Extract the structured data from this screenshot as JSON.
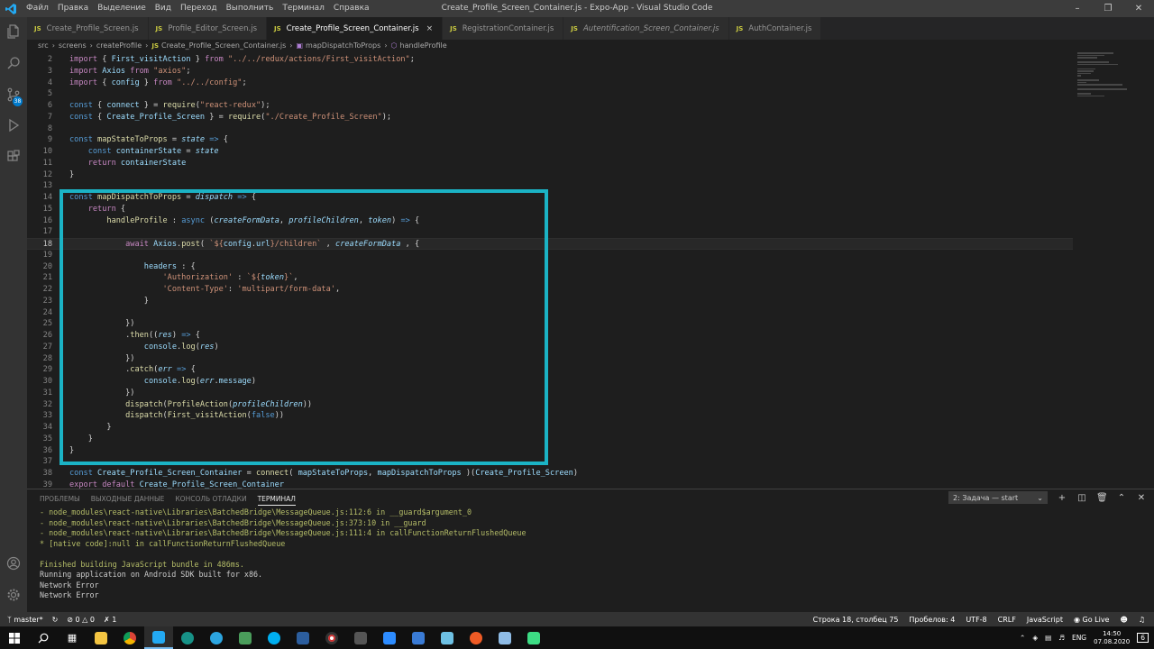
{
  "window": {
    "title": "Create_Profile_Screen_Container.js - Expo-App - Visual Studio Code",
    "menu": [
      "Файл",
      "Правка",
      "Выделение",
      "Вид",
      "Переход",
      "Выполнить",
      "Терминал",
      "Справка"
    ]
  },
  "activity_bar": {
    "scm_badge": "38"
  },
  "tabs": [
    {
      "label": "Create_Profile_Screen.js",
      "active": false,
      "italic": false
    },
    {
      "label": "Profile_Editor_Screen.js",
      "active": false,
      "italic": false
    },
    {
      "label": "Create_Profile_Screen_Container.js",
      "active": true,
      "italic": false
    },
    {
      "label": "RegistrationContainer.js",
      "active": false,
      "italic": false
    },
    {
      "label": "Autentification_Screen_Container.js",
      "active": false,
      "italic": true
    },
    {
      "label": "AuthContainer.js",
      "active": false,
      "italic": false
    }
  ],
  "tab_icon": "JS",
  "breadcrumb": [
    "src",
    "screens",
    "createProfile",
    "Create_Profile_Screen_Container.js",
    "mapDispatchToProps",
    "handleProfile"
  ],
  "code_lines": [
    {
      "n": "2",
      "t": [
        [
          "kw",
          "import"
        ],
        [
          "pr",
          " { "
        ],
        [
          "vr",
          "First_visitAction"
        ],
        [
          "pr",
          " } "
        ],
        [
          "kw",
          "from"
        ],
        [
          "st",
          " \"../../redux/actions/First_visitAction\""
        ],
        [
          "pr",
          ";"
        ]
      ]
    },
    {
      "n": "3",
      "t": [
        [
          "kw",
          "import"
        ],
        [
          "vr",
          " Axios "
        ],
        [
          "kw",
          "from"
        ],
        [
          "st",
          " \"axios\""
        ],
        [
          "pr",
          ";"
        ]
      ]
    },
    {
      "n": "4",
      "t": [
        [
          "kw",
          "import"
        ],
        [
          "pr",
          " { "
        ],
        [
          "vr",
          "config"
        ],
        [
          "pr",
          " } "
        ],
        [
          "kw",
          "from"
        ],
        [
          "st",
          " \"../../config\""
        ],
        [
          "pr",
          ";"
        ]
      ]
    },
    {
      "n": "5",
      "t": []
    },
    {
      "n": "6",
      "t": [
        [
          "sk",
          "const"
        ],
        [
          "pr",
          " { "
        ],
        [
          "vr",
          "connect"
        ],
        [
          "pr",
          " } = "
        ],
        [
          "fn",
          "require"
        ],
        [
          "pr",
          "("
        ],
        [
          "st",
          "\"react-redux\""
        ],
        [
          "pr",
          ");"
        ]
      ]
    },
    {
      "n": "7",
      "t": [
        [
          "sk",
          "const"
        ],
        [
          "pr",
          " { "
        ],
        [
          "vr",
          "Create_Profile_Screen"
        ],
        [
          "pr",
          " } = "
        ],
        [
          "fn",
          "require"
        ],
        [
          "pr",
          "("
        ],
        [
          "st",
          "\"./Create_Profile_Screen\""
        ],
        [
          "pr",
          ");"
        ]
      ]
    },
    {
      "n": "8",
      "t": []
    },
    {
      "n": "9",
      "t": [
        [
          "sk",
          "const"
        ],
        [
          "fn",
          " mapStateToProps"
        ],
        [
          "pr",
          " = "
        ],
        [
          "pm",
          "state"
        ],
        [
          "sk",
          " =>"
        ],
        [
          "pr",
          " {"
        ]
      ]
    },
    {
      "n": "10",
      "t": [
        [
          "pr",
          "    "
        ],
        [
          "sk",
          "const"
        ],
        [
          "vr",
          " containerState"
        ],
        [
          "pr",
          " = "
        ],
        [
          "pm",
          "state"
        ]
      ]
    },
    {
      "n": "11",
      "t": [
        [
          "pr",
          "    "
        ],
        [
          "kw",
          "return"
        ],
        [
          "vr",
          " containerState"
        ]
      ]
    },
    {
      "n": "12",
      "t": [
        [
          "pr",
          "}"
        ]
      ]
    },
    {
      "n": "13",
      "t": []
    },
    {
      "n": "14",
      "t": [
        [
          "sk",
          "const"
        ],
        [
          "fn",
          " mapDispatchToProps"
        ],
        [
          "pr",
          " = "
        ],
        [
          "pm",
          "dispatch"
        ],
        [
          "sk",
          " =>"
        ],
        [
          "pr",
          " {"
        ]
      ]
    },
    {
      "n": "15",
      "t": [
        [
          "pr",
          "    "
        ],
        [
          "kw",
          "return"
        ],
        [
          "pr",
          " {"
        ]
      ]
    },
    {
      "n": "16",
      "t": [
        [
          "pr",
          "        "
        ],
        [
          "fn",
          "handleProfile"
        ],
        [
          "pr",
          " : "
        ],
        [
          "sk",
          "async"
        ],
        [
          "pr",
          " ("
        ],
        [
          "pm",
          "createFormData"
        ],
        [
          "pr",
          ", "
        ],
        [
          "pm",
          "profileChildren"
        ],
        [
          "pr",
          ", "
        ],
        [
          "pm",
          "token"
        ],
        [
          "pr",
          ") "
        ],
        [
          "sk",
          "=>"
        ],
        [
          "pr",
          " {"
        ]
      ]
    },
    {
      "n": "17",
      "t": []
    },
    {
      "n": "18",
      "t": [
        [
          "pr",
          "            "
        ],
        [
          "kw",
          "await"
        ],
        [
          "vr",
          " Axios"
        ],
        [
          "pr",
          "."
        ],
        [
          "fn",
          "post"
        ],
        [
          "pr",
          "( "
        ],
        [
          "st",
          "`${"
        ],
        [
          "vr",
          "config"
        ],
        [
          "pr",
          "."
        ],
        [
          "vr",
          "url"
        ],
        [
          "st",
          "}/children`"
        ],
        [
          "pr",
          " , "
        ],
        [
          "pm",
          "createFormData"
        ],
        [
          "pr",
          " , {"
        ]
      ],
      "current": true
    },
    {
      "n": "19",
      "t": []
    },
    {
      "n": "20",
      "t": [
        [
          "pr",
          "                "
        ],
        [
          "vr",
          "headers"
        ],
        [
          "pr",
          " : {"
        ]
      ]
    },
    {
      "n": "21",
      "t": [
        [
          "pr",
          "                    "
        ],
        [
          "st",
          "'Authorization'"
        ],
        [
          "pr",
          " : "
        ],
        [
          "st",
          "`${"
        ],
        [
          "pm",
          "token"
        ],
        [
          "st",
          "}`"
        ],
        [
          "pr",
          ","
        ]
      ]
    },
    {
      "n": "22",
      "t": [
        [
          "pr",
          "                    "
        ],
        [
          "st",
          "'Content-Type'"
        ],
        [
          "pr",
          ": "
        ],
        [
          "st",
          "'multipart/form-data'"
        ],
        [
          "pr",
          ","
        ]
      ]
    },
    {
      "n": "23",
      "t": [
        [
          "pr",
          "                }"
        ]
      ]
    },
    {
      "n": "24",
      "t": []
    },
    {
      "n": "25",
      "t": [
        [
          "pr",
          "            })"
        ]
      ]
    },
    {
      "n": "26",
      "t": [
        [
          "pr",
          "            ."
        ],
        [
          "fn",
          "then"
        ],
        [
          "pr",
          "(("
        ],
        [
          "pm",
          "res"
        ],
        [
          "pr",
          ") "
        ],
        [
          "sk",
          "=>"
        ],
        [
          "pr",
          " {"
        ]
      ]
    },
    {
      "n": "27",
      "t": [
        [
          "pr",
          "                "
        ],
        [
          "vr",
          "console"
        ],
        [
          "pr",
          "."
        ],
        [
          "fn",
          "log"
        ],
        [
          "pr",
          "("
        ],
        [
          "pm",
          "res"
        ],
        [
          "pr",
          ")"
        ]
      ]
    },
    {
      "n": "28",
      "t": [
        [
          "pr",
          "            })"
        ]
      ]
    },
    {
      "n": "29",
      "t": [
        [
          "pr",
          "            ."
        ],
        [
          "fn",
          "catch"
        ],
        [
          "pr",
          "("
        ],
        [
          "pm",
          "err"
        ],
        [
          "sk",
          " =>"
        ],
        [
          "pr",
          " {"
        ]
      ]
    },
    {
      "n": "30",
      "t": [
        [
          "pr",
          "                "
        ],
        [
          "vr",
          "console"
        ],
        [
          "pr",
          "."
        ],
        [
          "fn",
          "log"
        ],
        [
          "pr",
          "("
        ],
        [
          "pm",
          "err"
        ],
        [
          "pr",
          "."
        ],
        [
          "vr",
          "message"
        ],
        [
          "pr",
          ")"
        ]
      ]
    },
    {
      "n": "31",
      "t": [
        [
          "pr",
          "            })"
        ]
      ]
    },
    {
      "n": "32",
      "t": [
        [
          "pr",
          "            "
        ],
        [
          "fn",
          "dispatch"
        ],
        [
          "pr",
          "("
        ],
        [
          "fn",
          "ProfileAction"
        ],
        [
          "pr",
          "("
        ],
        [
          "pm",
          "profileChildren"
        ],
        [
          "pr",
          "))"
        ]
      ]
    },
    {
      "n": "33",
      "t": [
        [
          "pr",
          "            "
        ],
        [
          "fn",
          "dispatch"
        ],
        [
          "pr",
          "("
        ],
        [
          "fn",
          "First_visitAction"
        ],
        [
          "pr",
          "("
        ],
        [
          "sk",
          "false"
        ],
        [
          "pr",
          "))"
        ]
      ]
    },
    {
      "n": "34",
      "t": [
        [
          "pr",
          "        }"
        ]
      ]
    },
    {
      "n": "35",
      "t": [
        [
          "pr",
          "    }"
        ]
      ]
    },
    {
      "n": "36",
      "t": [
        [
          "pr",
          "}"
        ]
      ]
    },
    {
      "n": "37",
      "t": []
    },
    {
      "n": "38",
      "t": [
        [
          "sk",
          "const"
        ],
        [
          "vr",
          " Create_Profile_Screen_Container"
        ],
        [
          "pr",
          " = "
        ],
        [
          "fn",
          "connect"
        ],
        [
          "pr",
          "( "
        ],
        [
          "vr",
          "mapStateToProps"
        ],
        [
          "pr",
          ", "
        ],
        [
          "vr",
          "mapDispatchToProps"
        ],
        [
          "pr",
          " )("
        ],
        [
          "vr",
          "Create_Profile_Screen"
        ],
        [
          "pr",
          ")"
        ]
      ]
    },
    {
      "n": "39",
      "t": [
        [
          "kw",
          "export"
        ],
        [
          "kw",
          " default"
        ],
        [
          "vr",
          " Create_Profile_Screen_Container"
        ]
      ]
    }
  ],
  "panel": {
    "tabs": [
      "ПРОБЛЕМЫ",
      "ВЫХОДНЫЕ ДАННЫЕ",
      "КОНСОЛЬ ОТЛАДКИ",
      "ТЕРМИНАЛ"
    ],
    "active_tab": "ТЕРМИНАЛ",
    "task_select": "2: Задача — start",
    "terminal_lines": [
      {
        "text": "- node_modules\\react-native\\Libraries\\BatchedBridge\\MessageQueue.js:112:6 in __guard$argument_0",
        "kind": "warn"
      },
      {
        "text": "- node_modules\\react-native\\Libraries\\BatchedBridge\\MessageQueue.js:373:10 in __guard",
        "kind": "warn"
      },
      {
        "text": "- node_modules\\react-native\\Libraries\\BatchedBridge\\MessageQueue.js:111:4 in callFunctionReturnFlushedQueue",
        "kind": "warn"
      },
      {
        "text": "* [native code]:null in callFunctionReturnFlushedQueue",
        "kind": "warn"
      },
      {
        "text": "",
        "kind": "norm"
      },
      {
        "text": "Finished building JavaScript bundle in 486ms.",
        "kind": "warn"
      },
      {
        "text": "Running application on Android SDK built for x86.",
        "kind": "norm"
      },
      {
        "text": "Network Error",
        "kind": "norm"
      },
      {
        "text": "Network Error",
        "kind": "norm"
      }
    ]
  },
  "statusbar": {
    "branch": "master*",
    "errors": "0",
    "warnings": "0",
    "sync": "1",
    "position": "Строка 18, столбец 75",
    "spaces": "Пробелов: 4",
    "encoding": "UTF-8",
    "eol": "CRLF",
    "language": "JavaScript",
    "golive": "Go Live"
  },
  "taskbar": {
    "lang": "ENG",
    "time": "14:50",
    "date": "07.08.2020",
    "notifications": "6"
  }
}
